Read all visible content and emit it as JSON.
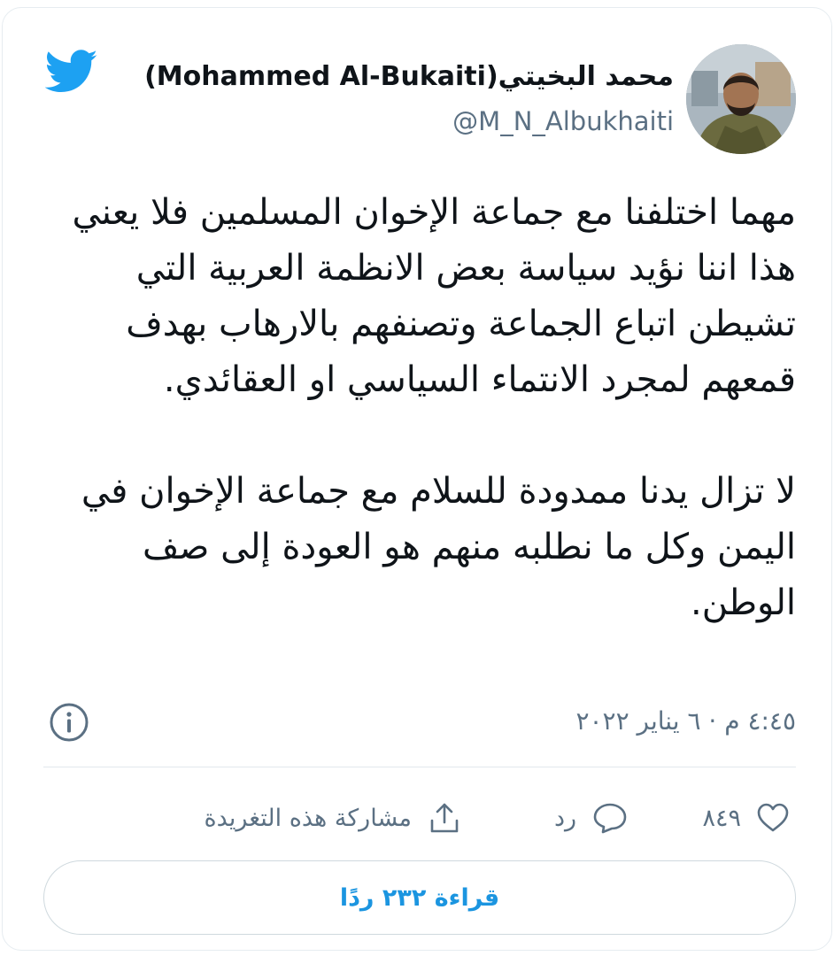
{
  "author": {
    "display_name": "محمد البخيتي(Mohammed Al-Bukaiti)",
    "handle": "@M_N_Albukhaiti"
  },
  "tweet": {
    "paragraph_1": "مهما اختلفنا مع جماعة الإخوان المسلمين فلا يعني هذا اننا نؤيد سياسة بعض الانظمة العربية التي تشيطن اتباع الجماعة وتصنفهم بالارهاب بهدف قمعهم لمجرد الانتماء السياسي او العقائدي.",
    "paragraph_2": "لا تزال يدنا ممدودة للسلام مع جماعة الإخوان في اليمن وكل ما نطلبه منهم هو العودة إلى صف الوطن."
  },
  "timestamp": "٤:٤٥ م · ٦ يناير ٢٠٢٢",
  "actions": {
    "like_count": "٨٤٩",
    "reply_label": "رد",
    "share_label": "مشاركة هذه التغريدة"
  },
  "read_replies_label": "قراءة ٢٣٢ ردًا",
  "icons": {
    "brand": "twitter-bird-icon",
    "info": "info-icon",
    "like": "heart-icon",
    "reply": "reply-bubble-icon",
    "share": "share-upload-icon"
  },
  "colors": {
    "twitter_blue": "#1da1f2",
    "secondary_text": "#5b7083",
    "link_blue": "#1b95e0",
    "border": "#e1e8ed"
  }
}
